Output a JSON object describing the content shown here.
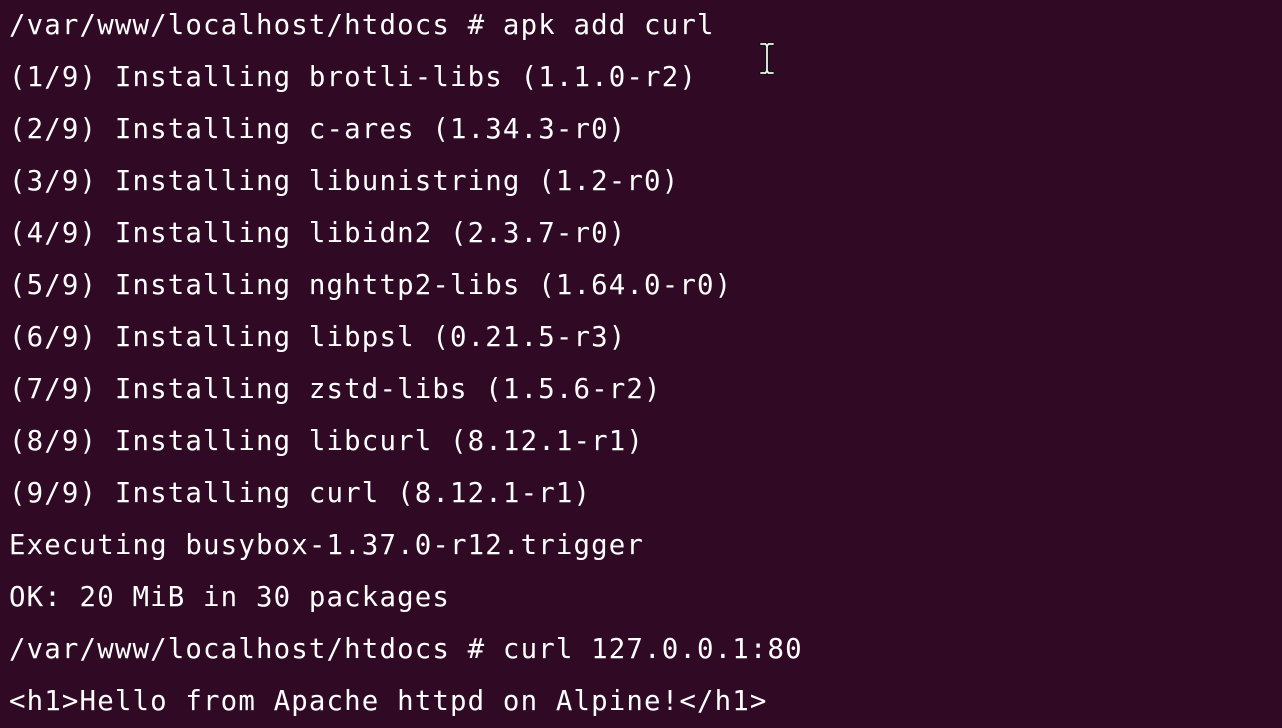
{
  "terminal": {
    "background": "#300a24",
    "foreground": "#ffffff",
    "lines": [
      "/var/www/localhost/htdocs # apk add curl",
      "(1/9) Installing brotli-libs (1.1.0-r2)",
      "(2/9) Installing c-ares (1.34.3-r0)",
      "(3/9) Installing libunistring (1.2-r0)",
      "(4/9) Installing libidn2 (2.3.7-r0)",
      "(5/9) Installing nghttp2-libs (1.64.0-r0)",
      "(6/9) Installing libpsl (0.21.5-r3)",
      "(7/9) Installing zstd-libs (1.5.6-r2)",
      "(8/9) Installing libcurl (8.12.1-r1)",
      "(9/9) Installing curl (8.12.1-r1)",
      "Executing busybox-1.37.0-r12.trigger",
      "OK: 20 MiB in 30 packages",
      "/var/www/localhost/htdocs # curl 127.0.0.1:80",
      "<h1>Hello from Apache httpd on Alpine!</h1>"
    ]
  },
  "pointer": {
    "icon": "text-cursor-ibeam-icon"
  }
}
